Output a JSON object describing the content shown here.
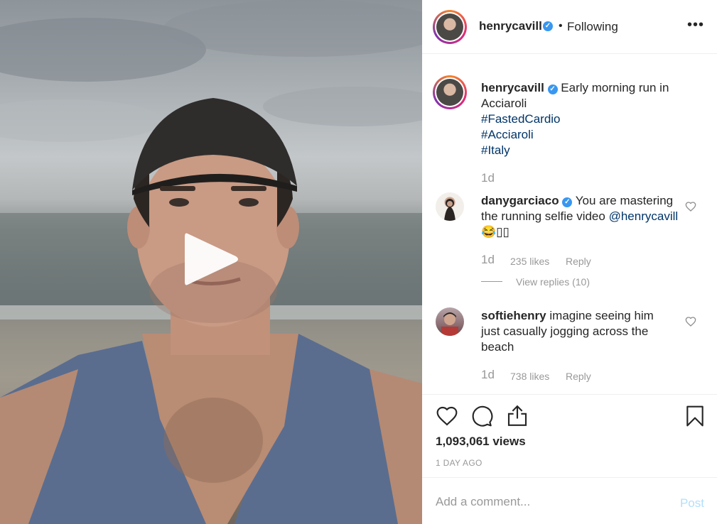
{
  "post": {
    "username": "henrycavill",
    "follow_status": "Following",
    "dot": "•",
    "more": "•••",
    "caption_text": "Early morning run in Acciaroli",
    "hashtags": [
      "#FastedCardio",
      "#Acciaroli",
      "#Italy"
    ],
    "caption_time": "1d"
  },
  "comments": [
    {
      "username": "danygarciaco",
      "verified": true,
      "text": "You are mastering the running selfie video",
      "mention": "@henrycavill",
      "emoji": "😂",
      "emoji_tail": "▯▯",
      "time": "1d",
      "likes": "235 likes",
      "reply": "Reply",
      "view_replies": "View replies (10)"
    },
    {
      "username": "softiehenry",
      "verified": false,
      "text": "imagine seeing him just casually jogging across the beach",
      "time": "1d",
      "likes": "738 likes",
      "reply": "Reply"
    }
  ],
  "stats": {
    "views": "1,093,061 views",
    "posted": "1 DAY AGO"
  },
  "composer": {
    "placeholder": "Add a comment...",
    "post_label": "Post"
  },
  "icons": {
    "verified": "verified-badge-icon",
    "like": "heart-icon",
    "comment": "comment-bubble-icon",
    "share": "share-icon",
    "save": "bookmark-icon",
    "play": "play-icon"
  },
  "colors": {
    "hashtag": "#003569",
    "verified": "#3897f0",
    "muted": "#999999",
    "post_disabled": "#b2dffc"
  }
}
